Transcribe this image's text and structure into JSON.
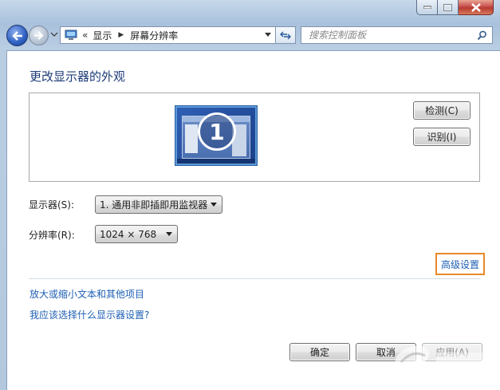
{
  "window": {
    "caption_buttons": [
      "minimize",
      "maximize",
      "close"
    ]
  },
  "nav": {
    "address_chevron": "«",
    "breadcrumb": [
      "显示",
      "屏幕分辨率"
    ],
    "search_placeholder": "搜索控制面板"
  },
  "main": {
    "title": "更改显示器的外观",
    "monitor_number": "1",
    "detect_button": "检测(C)",
    "identify_button": "识别(I)",
    "display_label": "显示器(S):",
    "display_value": "1. 通用非即插即用监视器",
    "resolution_label": "分辨率(R):",
    "resolution_value": "1024 × 768",
    "advanced_link": "高级设置",
    "links": [
      "放大或缩小文本和其他项目",
      "我应该选择什么显示器设置?"
    ]
  },
  "footer": {
    "ok_button": "确定",
    "cancel_button": "取消",
    "apply_button": "应用(A)"
  },
  "colors": {
    "link": "#1e5fb4",
    "title": "#1e3c78",
    "highlight_border": "#e88a2b"
  },
  "icons": [
    "back-arrow-icon",
    "forward-arrow-icon",
    "control-panel-icon",
    "refresh-icon",
    "search-icon",
    "dropdown-arrow-icon"
  ]
}
